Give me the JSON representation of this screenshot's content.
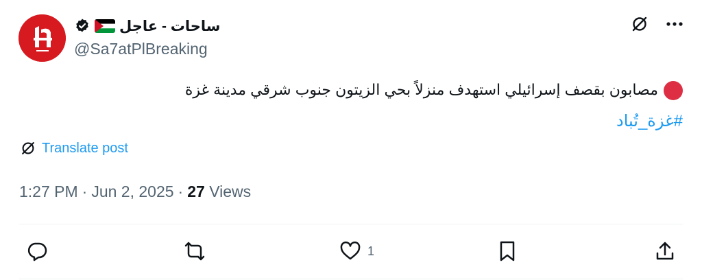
{
  "author": {
    "display_name": "ساحات - عاجل",
    "handle": "@Sa7atPlBreaking",
    "flag_icon": "palestine-flag-icon",
    "verified_icon": "verified-badge-icon"
  },
  "tweet": {
    "text": "مصابون بقصف إسرائيلي استهدف منزلاً بحي الزيتون جنوب شرقي مدينة غزة",
    "hashtag": "#غزة_تُباد"
  },
  "translate_label": "Translate post",
  "meta": {
    "time": "1:27 PM",
    "sep1": "·",
    "date": "Jun 2, 2025",
    "sep2": "·",
    "views_count": "27",
    "views_label": "Views"
  },
  "actions": {
    "like_count": "1"
  },
  "colors": {
    "accent": "#1d9bf0",
    "muted": "#536471",
    "brand_red": "#d71920",
    "dot_red": "#dd2e44"
  }
}
